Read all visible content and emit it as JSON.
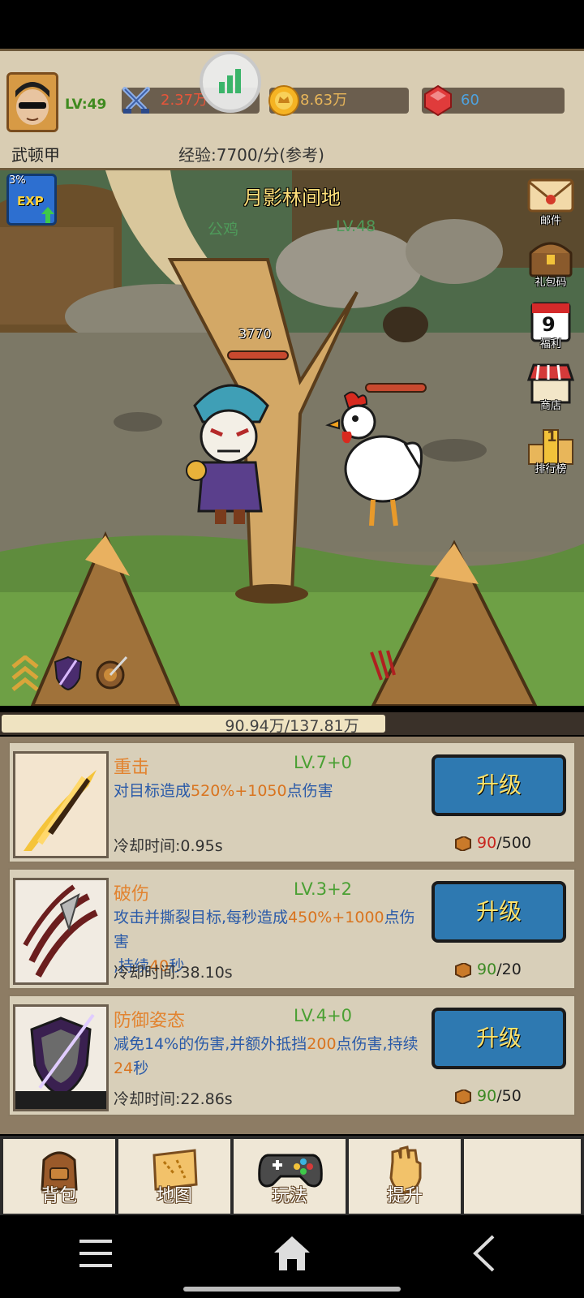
{
  "header": {
    "level": "LV:49",
    "player_name": "武顿甲",
    "power": "2.37万",
    "gold": "8.63万",
    "gems": "60",
    "exp_rate": "经验:7700/分(参考)"
  },
  "scene": {
    "map_name": "月影林间地",
    "exp_badge_percent": "3%",
    "exp_badge_label": "EXP",
    "enemy_name": "公鸡",
    "enemy_level": "LV.48",
    "player_hp_value": "3770",
    "side_buttons": [
      {
        "label": "邮件",
        "icon": "mail-icon"
      },
      {
        "label": "礼包码",
        "icon": "chest-icon"
      },
      {
        "label": "福利",
        "icon": "calendar-icon",
        "badge": "9"
      },
      {
        "label": "商店",
        "icon": "shop-icon"
      },
      {
        "label": "排行榜",
        "icon": "podium-icon",
        "badge": "1"
      }
    ]
  },
  "progress": {
    "text": "90.94万/137.81万",
    "fraction": 0.66
  },
  "skills": [
    {
      "name": "重击",
      "level": "LV.7+0",
      "desc_prefix": "对目标造成",
      "desc_highlight": "520%+1050",
      "desc_suffix": "点伤害",
      "cooldown": "冷却时间:0.95s",
      "upgrade_label": "升级",
      "cost_current": "90",
      "cost_total": "/500",
      "cost_status": "insufficient",
      "icon": "sword-slash-icon"
    },
    {
      "name": "破伤",
      "level": "LV.3+2",
      "desc_prefix": "攻击并撕裂目标,每秒造成",
      "desc_highlight": "450%+1000",
      "desc_suffix": "点伤害",
      "desc_line2_prefix": ",持续",
      "desc_line2_highlight": "40",
      "desc_line2_suffix": "秒",
      "cooldown": "冷却时间:38.10s",
      "upgrade_label": "升级",
      "cost_current": "90",
      "cost_total": "/20",
      "cost_status": "sufficient",
      "icon": "claw-slash-icon"
    },
    {
      "name": "防御姿态",
      "level": "LV.4+0",
      "desc_prefix": "减免14%的伤害,并额外抵挡",
      "desc_highlight": "200",
      "desc_suffix": "点伤害,持续",
      "desc_line2_prefix": "",
      "desc_line2_highlight": "24",
      "desc_line2_suffix": "秒",
      "cooldown": "冷却时间:22.86s",
      "upgrade_label": "升级",
      "cost_current": "90",
      "cost_total": "/50",
      "cost_status": "sufficient",
      "icon": "shield-icon"
    }
  ],
  "tabs": [
    {
      "label": "背包",
      "icon": "backpack-icon"
    },
    {
      "label": "地图",
      "icon": "map-scroll-icon"
    },
    {
      "label": "玩法",
      "icon": "gamepad-icon"
    },
    {
      "label": "提升",
      "icon": "fist-icon"
    }
  ],
  "colors": {
    "upgrade_button": "#2e79b1",
    "panel_bg": "#d8cfb9",
    "skill_name": "#e2832f",
    "skill_level": "#4aa033",
    "skill_desc": "#2a5aa8"
  }
}
